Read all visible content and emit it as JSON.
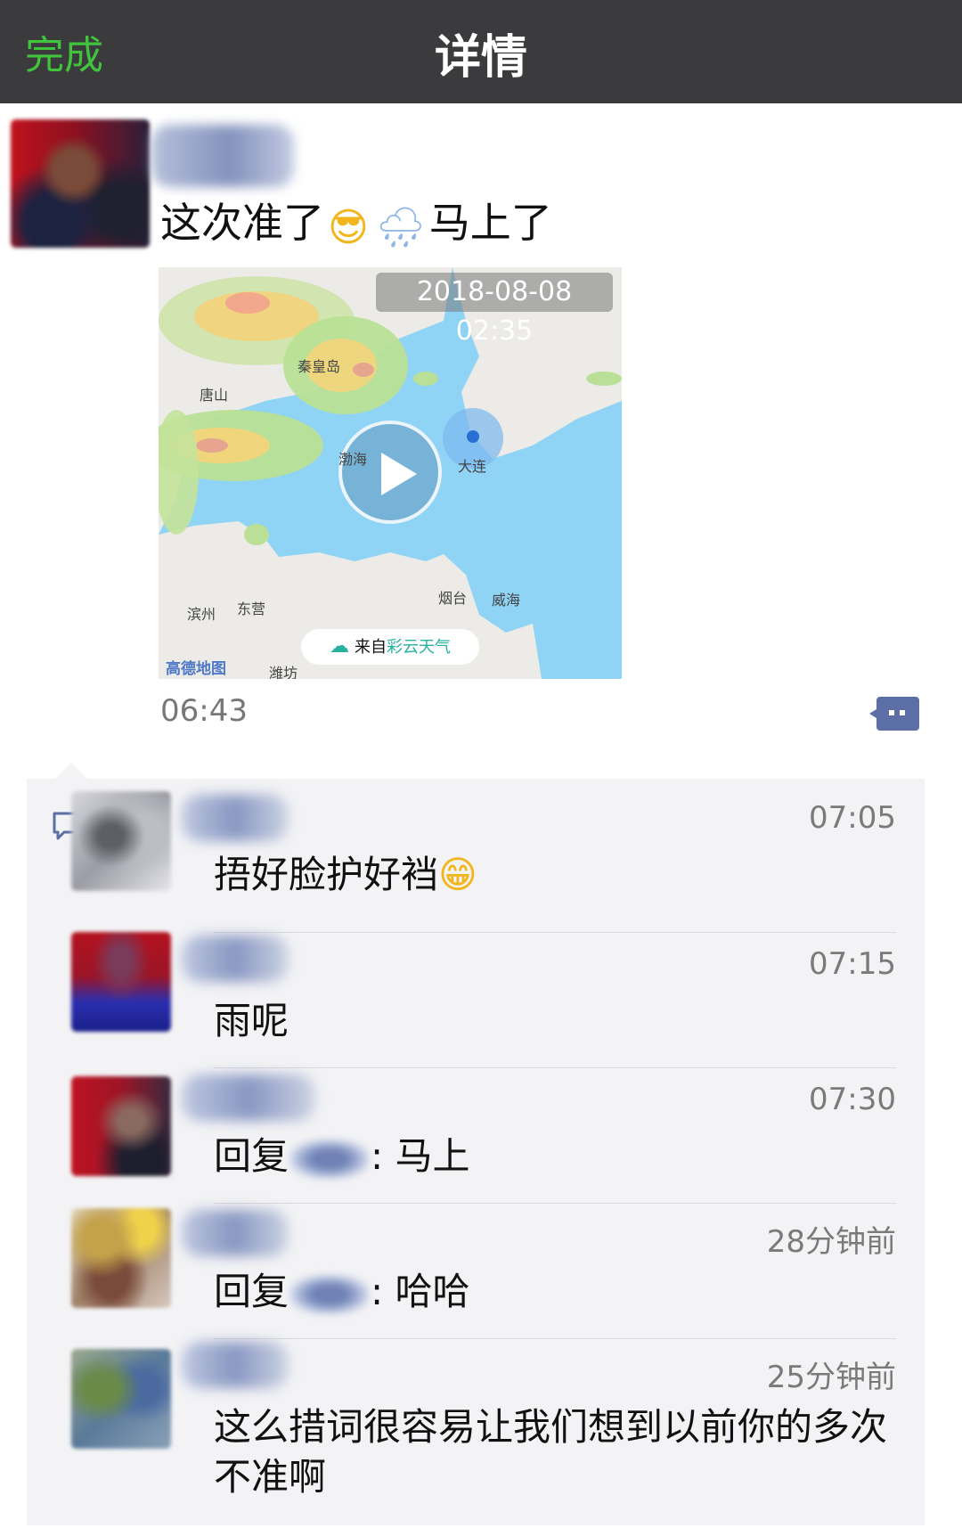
{
  "header": {
    "done_label": "完成",
    "title": "详情"
  },
  "post": {
    "text_before": "这次准了",
    "emoji_1": "😎",
    "emoji_2": "🌧",
    "text_after": "马上了",
    "video": {
      "timestamp": "2018-08-08 02:35",
      "source_prefix": "来自",
      "source_brand": "彩云天气",
      "map_provider": "高德地图",
      "map_labels": [
        "秦皇岛",
        "唐山",
        "渤海",
        "大连",
        "烟台",
        "威海",
        "滨州",
        "东营",
        "潍坊"
      ]
    },
    "time": "06:43"
  },
  "comments": [
    {
      "time": "07:05",
      "text": "捂好脸护好裆",
      "emoji": "😁"
    },
    {
      "time": "07:15",
      "text": "雨呢"
    },
    {
      "time": "07:30",
      "prefix": "回复",
      "suffix": ": 马上"
    },
    {
      "time": "28分钟前",
      "prefix": "回复",
      "suffix": ": 哈哈"
    },
    {
      "time": "25分钟前",
      "text": "这么措词很容易让我们想到以前你的多次不准啊"
    }
  ],
  "colors": {
    "header_bg": "#3b3b3d",
    "done_green": "#3fc43c",
    "comment_bg": "#f3f3f5",
    "accent_blue": "#5b6ea6"
  }
}
